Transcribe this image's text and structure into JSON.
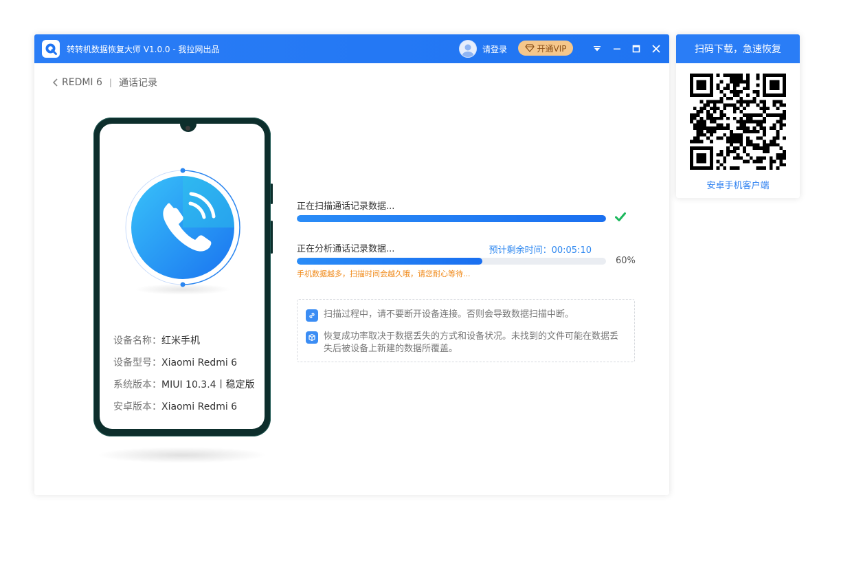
{
  "window": {
    "title": "转转机数据恢复大师 V1.0.0 - 我拉网出品",
    "login_label": "请登录",
    "vip_label": "开通VIP"
  },
  "breadcrumb": {
    "device": "REDMI 6",
    "separator": "|",
    "section": "通话记录"
  },
  "device_info": [
    {
      "label": "设备名称：",
      "value": "红米手机"
    },
    {
      "label": "设备型号：",
      "value": "Xiaomi Redmi 6"
    },
    {
      "label": "系统版本：",
      "value": "MIUI 10.3.4丨稳定版"
    },
    {
      "label": "安卓版本：",
      "value": "Xiaomi Redmi 6"
    }
  ],
  "tasks": {
    "scan": {
      "label": "正在扫描通话记录数据...",
      "progress": 1.0
    },
    "analyze": {
      "label": "正在分析通话记录数据...",
      "remaining_label": "预计剩余时间：00:05:10",
      "progress": 0.6,
      "percent_label": "60%",
      "warning": "手机数据越多，扫描时间会越久哦，请您耐心等待..."
    }
  },
  "notes": [
    "扫描过程中，请不要断开设备连接。否则会导致数据扫描中断。",
    "恢复成功率取决于数据丢失的方式和设备状况。未找到的文件可能在数据丢失后被设备上新建的数据所覆盖。"
  ],
  "qr_panel": {
    "header": "扫码下载，急速恢复",
    "caption": "安卓手机客户端"
  },
  "colors": {
    "primary": "#2a7df6",
    "success": "#1bb85c",
    "warning": "#f08a1a",
    "vip": "#f5c78b"
  }
}
